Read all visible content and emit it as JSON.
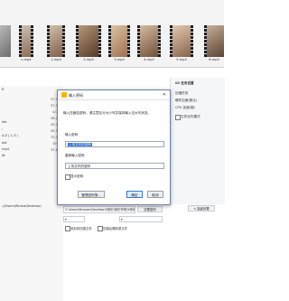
{
  "thumbnails": [
    {
      "label": ""
    },
    {
      "label": "c.mp4"
    },
    {
      "label": "1.mp4"
    },
    {
      "label": "2.mp4"
    },
    {
      "label": "3.mp4"
    },
    {
      "label": "4.mp4"
    },
    {
      "label": "5.mp4"
    },
    {
      "label": "6.mp4"
    }
  ],
  "left_panel": {
    "line1": "R",
    "line2": "",
    "line3": "lee",
    "line4": ":",
    "line5": "A-Z | 1-3 )",
    "line6": "ast",
    "line7": "mp4",
    "line8": "dt",
    "path_prefix": "://Users\\Wuma\\Desktop\\"
  },
  "props": {
    "row1_num": "21.0",
    "row1_text": "文件路径",
    "row2_num": "37.1 MB",
    "row2_text": "C:\\Users\\Wuman\\Desktop\\5绝伦\\2.mp4",
    "row3_num": "37.1 MB",
    "row4_num": "4.0 MB",
    "row5_num": "36.2 MB",
    "row6_num": "39.1 MB",
    "row7_num": "35.5 MB",
    "row8_num": "70.1 MB",
    "row9_num": "109 MB",
    "row10_num": "37.8 MB"
  },
  "right_panel": {
    "title": "02 任务设置",
    "item1": "压缩任务",
    "item2": "硬件加速(默认)",
    "item3": "CPU 加速(慢)",
    "item4": "文件优先模式"
  },
  "dialog": {
    "title": "输入密码",
    "close": "✕",
    "info": "输入压缩包密码，请注意区分大小写并保持输入法大写状态。",
    "label_pwd": "输入密码",
    "pwd_value": "上传文件的密码",
    "label_confirm": "重新输入密码",
    "confirm_value": "上传文件的密码",
    "show_pwd": "显示密码",
    "btn_manage": "管理密码薄...",
    "btn_ok": "确定",
    "btn_cancel": "取消"
  },
  "bottom": {
    "path_value": "C:\\Users\\Wuman\\Desktop\\5绝伦\\绝伦完成\\5绝伦",
    "btn_browse": "设置密码",
    "select1": "",
    "select2": "",
    "advanced": "< 高级设置",
    "check1": "添加到压缩文件",
    "check2": "压缩后删除原文件"
  }
}
